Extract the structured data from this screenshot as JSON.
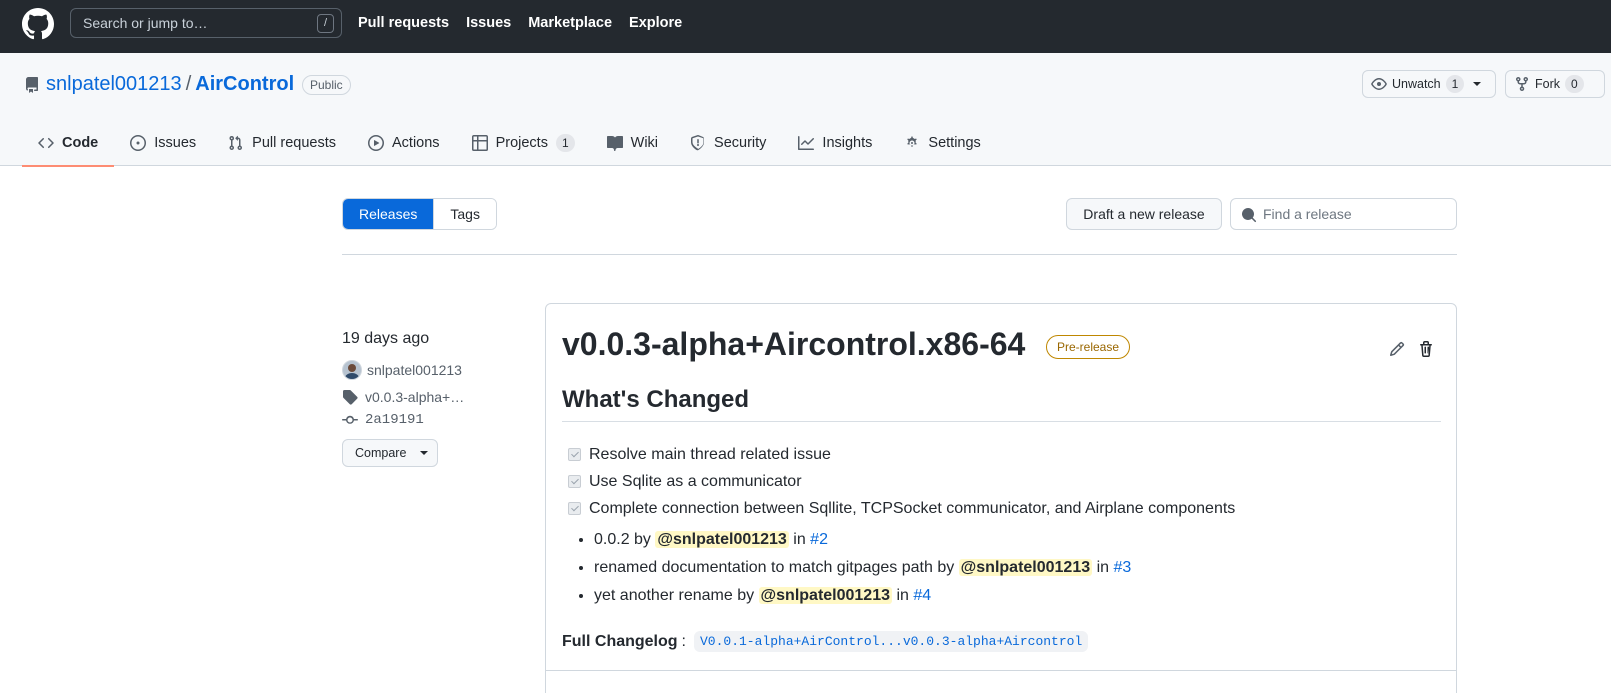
{
  "header": {
    "search_placeholder": "Search or jump to…",
    "search_shortcut": "/",
    "nav": [
      "Pull requests",
      "Issues",
      "Marketplace",
      "Explore"
    ]
  },
  "repo": {
    "owner": "snlpatel001213",
    "separator": "/",
    "name": "AirControl",
    "visibility": "Public",
    "unwatch_label": "Unwatch",
    "watch_count": "1",
    "fork_label": "Fork",
    "fork_count": "0",
    "tabs": [
      {
        "label": "Code",
        "icon": "code-icon",
        "active": true
      },
      {
        "label": "Issues",
        "icon": "issue-opened-icon"
      },
      {
        "label": "Pull requests",
        "icon": "git-pull-request-icon"
      },
      {
        "label": "Actions",
        "icon": "play-icon"
      },
      {
        "label": "Projects",
        "icon": "table-icon",
        "counter": "1"
      },
      {
        "label": "Wiki",
        "icon": "book-icon"
      },
      {
        "label": "Security",
        "icon": "shield-icon"
      },
      {
        "label": "Insights",
        "icon": "graph-icon"
      },
      {
        "label": "Settings",
        "icon": "gear-icon"
      }
    ]
  },
  "subnav": {
    "releases_label": "Releases",
    "tags_label": "Tags",
    "draft_label": "Draft a new release",
    "find_placeholder": "Find a release"
  },
  "release": {
    "date": "19 days ago",
    "author": "snlpatel001213",
    "tag": "v0.0.3-alpha+…",
    "commit": "2a19191",
    "compare_label": "Compare",
    "title": "v0.0.3-alpha+Aircontrol.x86-64",
    "badge": "Pre-release",
    "heading": "What's Changed",
    "tasks": [
      "Resolve main thread related issue",
      "Use Sqlite as a communicator",
      "Complete connection between Sqllite, TCPSocket communicator, and Airplane components"
    ],
    "changes": [
      {
        "text": "0.0.2 by ",
        "mention": "@snlpatel001213",
        "in": " in ",
        "link": "#2"
      },
      {
        "text": "renamed documentation to match gitpages path by ",
        "mention": "@snlpatel001213",
        "in": " in ",
        "link": "#3"
      },
      {
        "text": "yet another rename by ",
        "mention": "@snlpatel001213",
        "in": " in ",
        "link": "#4"
      }
    ],
    "changelog_label": "Full Changelog",
    "changelog_colon": ":",
    "changelog_link": "V0.0.1-alpha+AirControl...v0.0.3-alpha+Aircontrol"
  },
  "colors": {
    "header_bg": "#24292f",
    "accent": "#0969da",
    "active_tab_underline": "#fd8c73",
    "prerelease": "#9a6700",
    "mention_bg": "#fff8c5"
  }
}
